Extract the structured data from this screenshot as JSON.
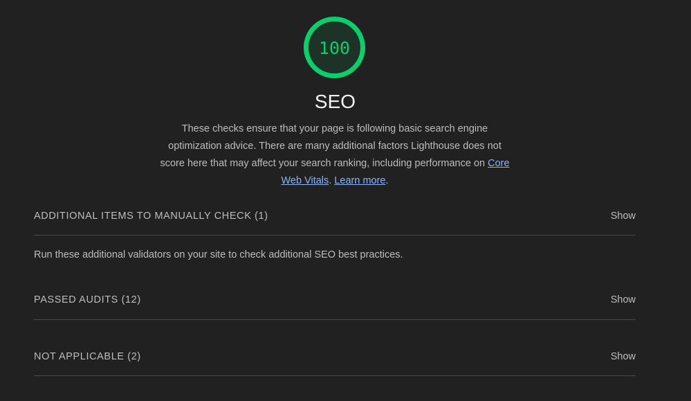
{
  "score": {
    "value": "100",
    "fraction": 1.0,
    "color": "#0cce6b"
  },
  "category": {
    "title": "SEO",
    "description_text": "These checks ensure that your page is following basic search engine optimization advice. There are many additional factors Lighthouse does not score here that may affect your search ranking, including performance on ",
    "link_core_web_vitals": "Core Web Vitals",
    "separator": ". ",
    "link_learn_more": "Learn more",
    "end": "."
  },
  "groups": {
    "manual": {
      "title": "ADDITIONAL ITEMS TO MANUALLY CHECK (1)",
      "show_label": "Show",
      "description": "Run these additional validators on your site to check additional SEO best practices."
    },
    "passed": {
      "title": "PASSED AUDITS (12)",
      "show_label": "Show"
    },
    "not_applicable": {
      "title": "NOT APPLICABLE (2)",
      "show_label": "Show"
    }
  },
  "colors": {
    "background": "#212121",
    "text": "#bdbdbd",
    "title": "#f5f5f5",
    "link": "#8ab4f8",
    "pass": "#0cce6b",
    "gauge_fill": "#1f3a2b"
  }
}
